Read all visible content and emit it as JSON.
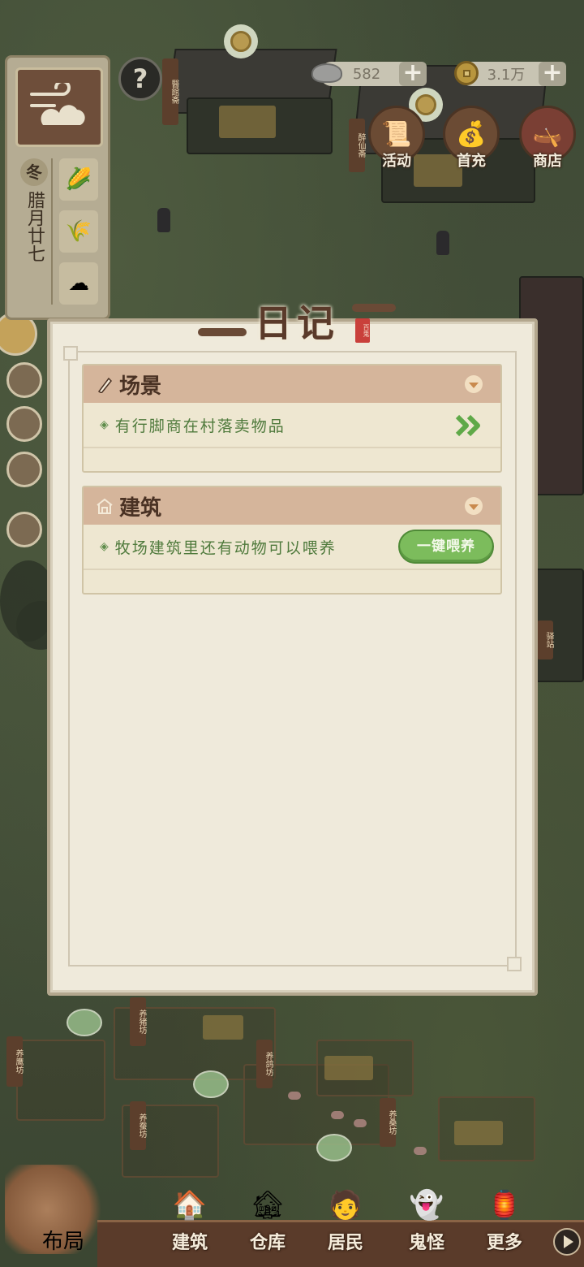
{
  "currency": {
    "silver_value": "582",
    "copper_value": "3.1万",
    "plus_glyph": "+"
  },
  "calendar": {
    "season": "冬",
    "date": "腊月廿七"
  },
  "help_glyph": "?",
  "features": [
    {
      "label": "活动",
      "icon": "scroll-icon"
    },
    {
      "label": "首充",
      "icon": "money-bag-icon"
    },
    {
      "label": "商店",
      "icon": "shop-boat-icon"
    }
  ],
  "scene_signs": {
    "s1": "醫館斋",
    "s2": "醉仙斋",
    "s3": "驿站",
    "s4": "养鹰坊",
    "s5": "养猪坊",
    "s6": "养鸽坊",
    "s7": "养桑坊",
    "s8": "养蚕坊"
  },
  "diary": {
    "title": "日记",
    "seal": "百鬼",
    "sections": [
      {
        "title": "场景",
        "icon": "brush-icon",
        "entry": "有行脚商在村落卖物品",
        "action": "go-arrow"
      },
      {
        "title": "建筑",
        "icon": "house-icon",
        "entry": "牧场建筑里还有动物可以喂养",
        "action_label": "一键喂养"
      }
    ]
  },
  "nav": {
    "layout": "布局",
    "build": "建筑",
    "warehouse": "仓库",
    "residents": "居民",
    "ghosts": "鬼怪",
    "more": "更多"
  },
  "colors": {
    "modal_bg": "#efeadb",
    "section_header": "#d5b59b",
    "entry_text": "#4f7a3c",
    "feed_button": "#7cbc5c",
    "nav_strip": "#5a3b2a"
  }
}
